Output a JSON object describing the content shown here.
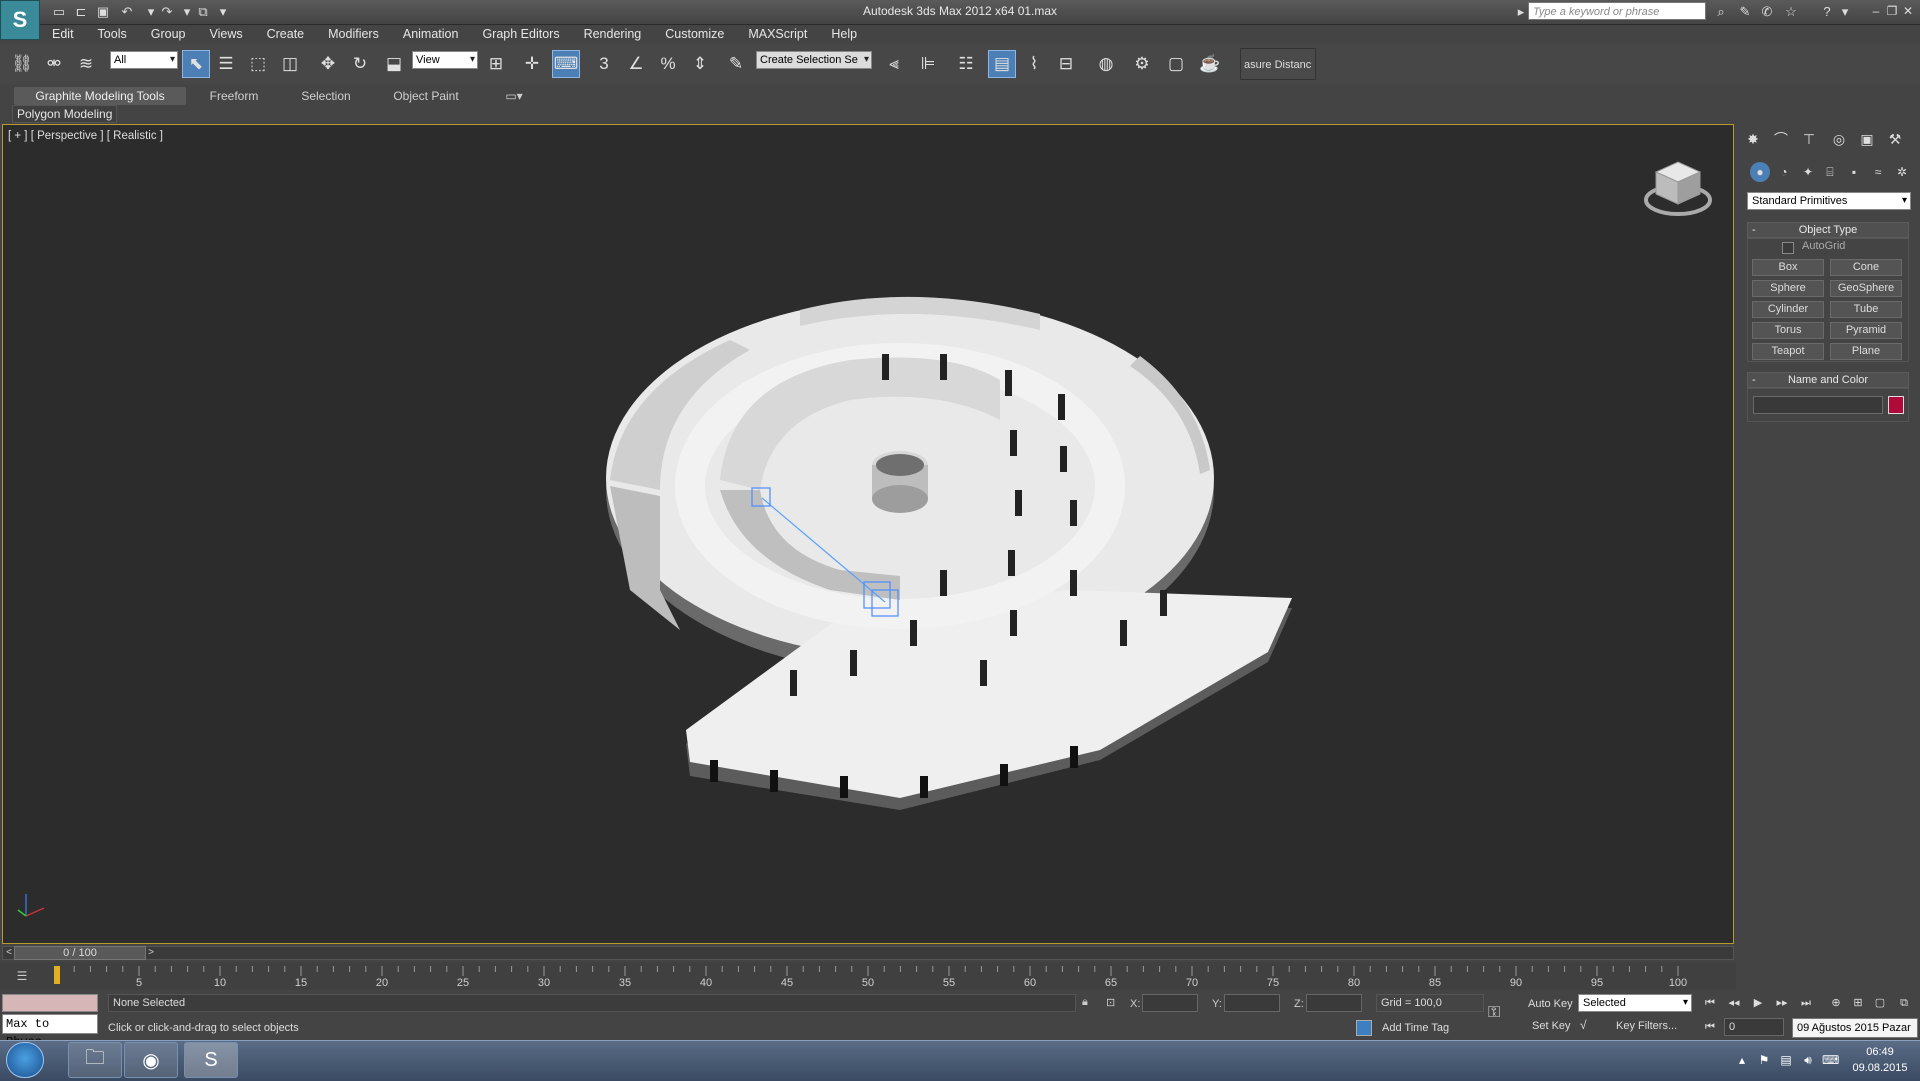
{
  "window": {
    "title": "Autodesk 3ds Max  2012 x64      01.max",
    "search_placeholder": "Type a keyword or phrase",
    "logo_text": "S"
  },
  "menu": [
    "Edit",
    "Tools",
    "Group",
    "Views",
    "Create",
    "Modifiers",
    "Animation",
    "Graph Editors",
    "Rendering",
    "Customize",
    "MAXScript",
    "Help"
  ],
  "toolbar": {
    "filter_select": "All",
    "reference_coord_select": "View",
    "named_selection_select": "Create Selection Se",
    "measure_distance": "asure Distanc",
    "snap_3d": "3",
    "percent_snap": "%"
  },
  "ribbon": {
    "tabs": [
      "Graphite Modeling Tools",
      "Freeform",
      "Selection",
      "Object Paint"
    ],
    "panel_label": "Polygon Modeling"
  },
  "viewport": {
    "label": "[ + ] [ Perspective ] [ Realistic ]"
  },
  "command_panel": {
    "category_select": "Standard Primitives",
    "object_type_title": "Object Type",
    "autogrid_label": "AutoGrid",
    "primitives": [
      "Box",
      "Cone",
      "Sphere",
      "GeoSphere",
      "Cylinder",
      "Tube",
      "Torus",
      "Pyramid",
      "Teapot",
      "Plane"
    ],
    "name_color_title": "Name and Color",
    "rollout_collapse": "-",
    "object_color": "#b00a3a"
  },
  "timeline": {
    "slider_label": "0 / 100",
    "ticks": [
      "5",
      "10",
      "15",
      "20",
      "25",
      "30",
      "35",
      "40",
      "45",
      "50",
      "55",
      "60",
      "65",
      "70",
      "75",
      "80",
      "85",
      "90",
      "95",
      "100"
    ],
    "prev_arrow": "<",
    "next_arrow": ">"
  },
  "status": {
    "maxscript_listener": "Max to Physc.",
    "selection": "None Selected",
    "prompt": "Click or click-and-drag to select objects",
    "x_label": "X:",
    "y_label": "Y:",
    "z_label": "Z:",
    "grid": "Grid = 100,0",
    "add_time_tag": "Add Time Tag",
    "auto_key": "Auto Key",
    "set_key": "Set Key",
    "key_filters": "Key Filters...",
    "key_mode_select": "Selected",
    "current_frame": "0",
    "date_tooltip": "09 Ağustos 2015 Pazar"
  },
  "taskbar": {
    "time": "06:49",
    "date": "09.08.2015"
  }
}
